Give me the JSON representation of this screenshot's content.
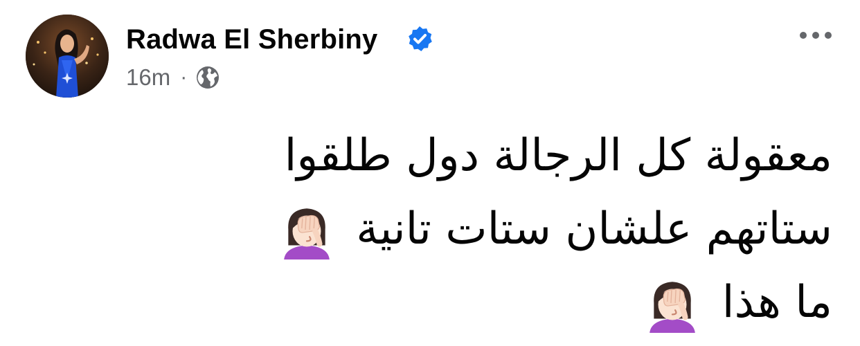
{
  "post": {
    "author": {
      "name": "Radwa El Sherbiny",
      "verified": true,
      "avatar_icon": "profile-photo-woman-blue-dress"
    },
    "meta": {
      "time": "16m",
      "separator": "·",
      "audience_icon": "globe-icon"
    },
    "menu_icon": "more-options-icon",
    "lines": [
      "معقولة كل الرجالة دول طلقوا",
      "ستاتهم علشان ستات تانية",
      "ما هذا"
    ],
    "emoji": "face-palm-woman-emoji"
  },
  "colors": {
    "verified_blue": "#1877f2",
    "secondary_text": "#65676b",
    "primary_text": "#050505",
    "emoji_hair": "#3a2a26",
    "emoji_shirt": "#a34cc7"
  }
}
